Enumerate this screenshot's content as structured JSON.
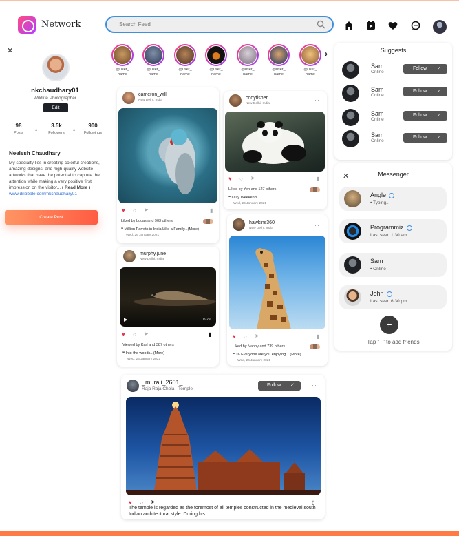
{
  "header": {
    "brand": "Network",
    "search_placeholder": "Search Feed",
    "nav_icons": [
      "home-icon",
      "calendar-icon",
      "heart-icon",
      "chat-icon",
      "user-avatar"
    ]
  },
  "profile": {
    "username": "nkchaudhary01",
    "title": "Wildlife Photographer",
    "edit_label": "Edit",
    "stats": [
      {
        "value": "98",
        "label": "Posts"
      },
      {
        "value": "3.5k",
        "label": "Followers"
      },
      {
        "value": "900",
        "label": "Followings"
      }
    ],
    "name": "Neelesh Chaudhary",
    "bio": "My specialty lies in creating colorful creations, amazing designs, and high-quality website artworks that have the potential to capture the attention while making a very positive first impression on the visitor...",
    "read_more": "( Read More )",
    "link": "www.dribbble.com/nkchaudhary01",
    "create_label": "Create Post"
  },
  "stories": [
    {
      "label": "@user_ name"
    },
    {
      "label": "@user_ name"
    },
    {
      "label": "@user_ name"
    },
    {
      "label": "@user_ name"
    },
    {
      "label": "@user_ name"
    },
    {
      "label": "@user_ name"
    },
    {
      "label": "@user_ name"
    }
  ],
  "posts": {
    "p1": {
      "user": "cameron_will",
      "loc": "New Delhi, India",
      "likes": "Liked by Lucas and 903 others",
      "caption": "Million Parrots in India Like a Family...(More)",
      "date": "Wed, 26 January 2021"
    },
    "p2": {
      "user": "codyfisher",
      "loc": "New Delhi, India",
      "likes": "Liked by Yen and 127 others",
      "caption": "Lazy Weekend",
      "date": "Wed, 26 January 2021"
    },
    "p3": {
      "user": "murphy.june",
      "loc": "New Delhi, India",
      "likes": "Viewed by Karl and 387 others",
      "caption": "Into the woods...(More)",
      "date": "Wed, 26 January 2021",
      "duration": "05:29"
    },
    "p4": {
      "user": "hawkins360",
      "loc": "New Delhi, India",
      "likes": "Liked by Nanny and 739 others",
      "caption": "16 Everyone are you enjoying... (More)",
      "date": "Wed, 26 January 2021"
    },
    "p5": {
      "user": "_murali_2601_",
      "loc": "Raja Raja Chola - Temple",
      "follow": "Follow",
      "text": "The temple is regarded as the foremost of all temples constructed in the medieval south Indian architectural style. During his"
    }
  },
  "suggests": {
    "title": "Suggests",
    "follow_label": "Follow",
    "items": [
      {
        "name": "Sam",
        "status": "Online"
      },
      {
        "name": "Sam",
        "status": "Online"
      },
      {
        "name": "Sam",
        "status": "Online"
      },
      {
        "name": "Sam",
        "status": "Online"
      }
    ]
  },
  "messenger": {
    "title": "Messenger",
    "items": [
      {
        "name": "Angle",
        "status": "Typing..."
      },
      {
        "name": "Programmiz",
        "status": "Last seen 1:30 am"
      },
      {
        "name": "Sam",
        "status": "Online"
      },
      {
        "name": "John",
        "status": "Last seen 6:30 pm"
      }
    ],
    "add_text": "Tap \"+\" to add friends"
  },
  "colors": {
    "accent": "#ff6a45",
    "search_border": "#3d8fe0",
    "heart": "#e3344b"
  }
}
